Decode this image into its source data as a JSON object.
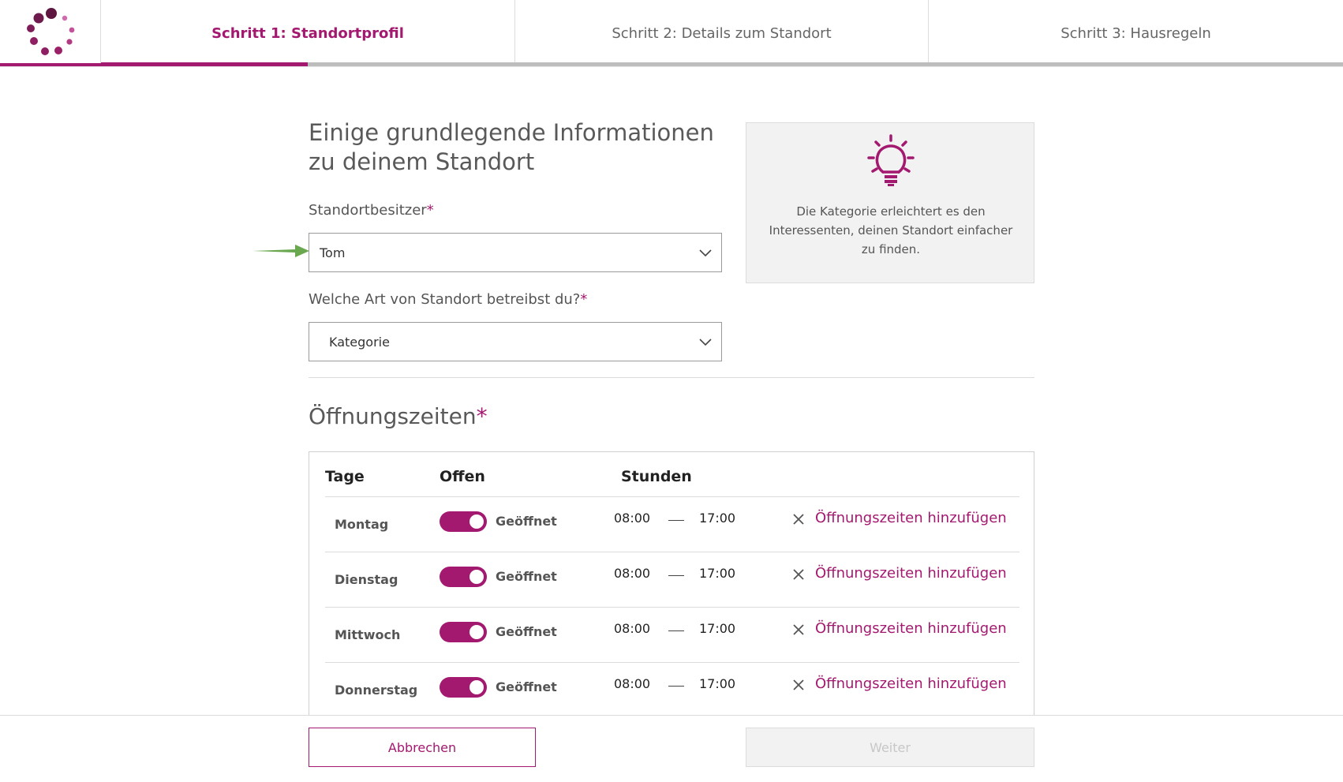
{
  "colors": {
    "accent": "#a3196f",
    "progress_track": "#bdbdbd",
    "hint_arrow": "#6aa84f"
  },
  "stepper": {
    "steps": [
      {
        "label": "Schritt 1: Standortprofil",
        "active": true
      },
      {
        "label": "Schritt 2: Details zum Standort",
        "active": false
      },
      {
        "label": "Schritt 3: Hausregeln",
        "active": false
      }
    ]
  },
  "form": {
    "heading_line1": "Einige grundlegende Informationen",
    "heading_line2": "zu deinem Standort",
    "owner_label": "Standortbesitzer",
    "owner_value": "Tom",
    "type_label": "Welche Art von Standort betreibst du?",
    "type_value": "Kategorie",
    "required_mark": "*"
  },
  "tip": {
    "icon": "lightbulb-icon",
    "text": "Die Kategorie erleichtert es den Interessenten, deinen Standort einfacher zu finden."
  },
  "hours": {
    "title": "Öffnungszeiten",
    "headers": {
      "days": "Tage",
      "open": "Offen",
      "hours": "Stunden"
    },
    "rows": [
      {
        "day": "Montag",
        "status": "Geöffnet",
        "from": "08:00",
        "to": "17:00",
        "add_label": "Öffnungszeiten hinzufügen"
      },
      {
        "day": "Dienstag",
        "status": "Geöffnet",
        "from": "08:00",
        "to": "17:00",
        "add_label": "Öffnungszeiten hinzufügen"
      },
      {
        "day": "Mittwoch",
        "status": "Geöffnet",
        "from": "08:00",
        "to": "17:00",
        "add_label": "Öffnungszeiten hinzufügen"
      },
      {
        "day": "Donnerstag",
        "status": "Geöffnet",
        "from": "08:00",
        "to": "17:00",
        "add_label": "Öffnungszeiten hinzufügen"
      }
    ]
  },
  "footer": {
    "cancel_label": "Abbrechen",
    "next_label": "Weiter"
  }
}
